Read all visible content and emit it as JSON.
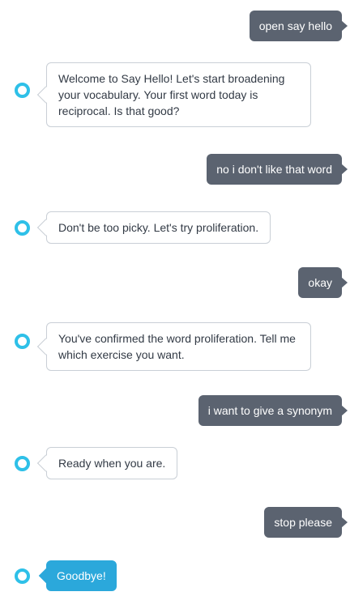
{
  "conversation": {
    "user_1": "open say hello",
    "alexa_1": "Welcome to Say Hello! Let's start broadening your vocabulary. Your first word today is reciprocal. Is that good?",
    "user_2": "no i don't like that word",
    "alexa_2": "Don't be too picky. Let's try proliferation.",
    "user_3": "okay",
    "alexa_3": "You've confirmed the word proliferation. Tell me which exercise you want.",
    "user_4": "i want to give a synonym",
    "alexa_4": "Ready when you are.",
    "user_5": "stop please",
    "alexa_5": "Goodbye!"
  },
  "colors": {
    "user_bubble": "#5b6370",
    "alexa_ring": "#2ec0e8",
    "final_bubble": "#2ba8db"
  },
  "icons": {
    "assistant": "alexa-ring-icon"
  }
}
